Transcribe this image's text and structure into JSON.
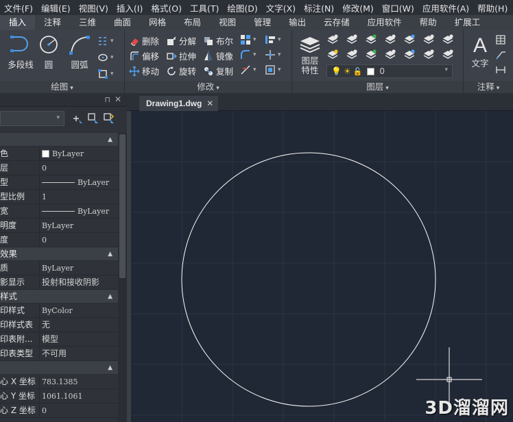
{
  "menu": [
    "文件(F)",
    "编辑(E)",
    "视图(V)",
    "插入(I)",
    "格式(O)",
    "工具(T)",
    "绘图(D)",
    "文字(X)",
    "标注(N)",
    "修改(M)",
    "窗口(W)",
    "应用软件(A)",
    "帮助(H)"
  ],
  "tabs": [
    "插入",
    "注释",
    "三维",
    "曲面",
    "网格",
    "布局",
    "视图",
    "管理",
    "输出",
    "云存储",
    "应用软件",
    "帮助",
    "扩展工"
  ],
  "ribbon": {
    "draw": {
      "title": "绘图",
      "polyline": "多段线",
      "circle": "圆",
      "arc": "圆弧"
    },
    "modify": {
      "title": "修改",
      "erase": "删除",
      "explode": "分解",
      "boolean": "布尔",
      "offset": "偏移",
      "stretch": "拉伸",
      "mirror": "镜像",
      "move": "移动",
      "rotate": "旋转",
      "copy": "复制"
    },
    "layer": {
      "title": "图层",
      "props": "图层\n特性",
      "props_l1": "图层",
      "props_l2": "特性",
      "current": "0"
    },
    "annot": {
      "title": "注释",
      "text": "文字"
    }
  },
  "document": {
    "tab": "Drawing1.dwg"
  },
  "properties": {
    "sections": {
      "general_rows": [
        {
          "k": "色",
          "v": "ByLayer",
          "type": "swatch"
        },
        {
          "k": "层",
          "v": "0",
          "type": "text"
        },
        {
          "k": "型",
          "v": "ByLayer",
          "type": "line"
        },
        {
          "k": "型比例",
          "v": "1",
          "type": "text"
        },
        {
          "k": "宽",
          "v": "ByLayer",
          "type": "line"
        },
        {
          "k": "明度",
          "v": "ByLayer",
          "type": "text"
        },
        {
          "k": "度",
          "v": "0",
          "type": "text"
        }
      ],
      "three_d_title": "效果",
      "three_d_rows": [
        {
          "k": "质",
          "v": "ByLayer"
        },
        {
          "k": "影显示",
          "v": "投射和接收阴影"
        }
      ],
      "print_title": "样式",
      "print_rows": [
        {
          "k": "印样式",
          "v": "ByColor"
        },
        {
          "k": "印样式表",
          "v": "无"
        },
        {
          "k": "印表附...",
          "v": "模型"
        },
        {
          "k": "印表类型",
          "v": "不可用"
        }
      ],
      "view_rows": [
        {
          "k": "心 X 坐标",
          "v": "783.1385"
        },
        {
          "k": "心 Y 坐标",
          "v": "1061.1061"
        },
        {
          "k": "心 Z 坐标",
          "v": "0"
        }
      ]
    }
  },
  "watermark": "3D溜溜网",
  "colors": {
    "canvas": "#212835",
    "menubar": "#2b2f36",
    "ribbon": "#3d4149",
    "accent_blue": "#3c8be0"
  }
}
